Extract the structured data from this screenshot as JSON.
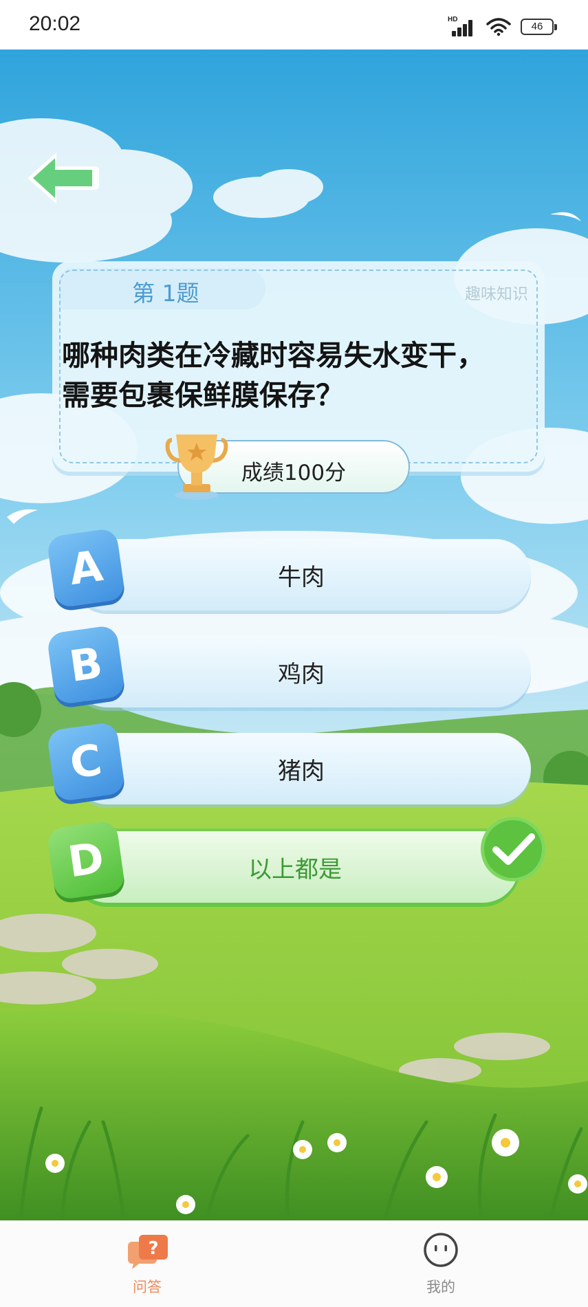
{
  "status_bar": {
    "time": "20:02",
    "network_label": "HD",
    "battery_level": "46",
    "icons": [
      "signal-icon",
      "wifi-icon",
      "battery-icon"
    ]
  },
  "header": {
    "back_icon": "back-arrow-icon"
  },
  "question": {
    "number_label": "第 1题",
    "category": "趣味知识",
    "text_line1": "哪种肉类在冷藏时容易失水变干，",
    "text_line2": "需要包裹保鲜膜保存？"
  },
  "score": {
    "label": "成绩100分",
    "icon": "trophy-icon"
  },
  "options": [
    {
      "letter": "A",
      "text": "牛肉",
      "correct": false
    },
    {
      "letter": "B",
      "text": "鸡肉",
      "correct": false
    },
    {
      "letter": "C",
      "text": "猪肉",
      "correct": false
    },
    {
      "letter": "D",
      "text": "以上都是",
      "correct": true
    }
  ],
  "bottom_nav": [
    {
      "label": "问答",
      "icon": "qa-icon",
      "active": true
    },
    {
      "label": "我的",
      "icon": "profile-face-icon",
      "active": false
    }
  ],
  "colors": {
    "primary_blue": "#4c9bd1",
    "correct_green": "#4fbf38",
    "active_nav": "#f08a5a"
  }
}
